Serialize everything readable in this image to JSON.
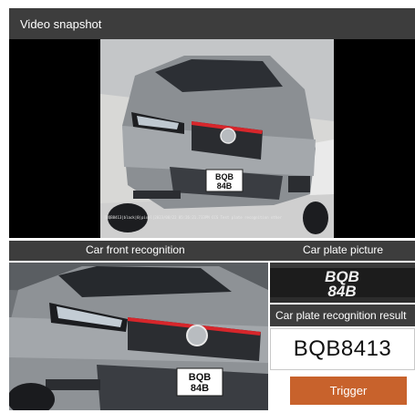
{
  "header": {
    "title": "Video snapshot"
  },
  "video": {
    "caption": "[BQB8413|black|0|pixel|2023/08/22 05:26:21.733PM CCS Test plate recognition other"
  },
  "sections": {
    "front_label": "Car front recognition",
    "plate_label": "Car plate picture",
    "result_label": "Car plate recognition result"
  },
  "plate": {
    "picture_line1": "BQB",
    "picture_line2": "84B",
    "result": "BQB8413"
  },
  "button": {
    "trigger_label": "Trigger"
  },
  "colors": {
    "header_bg": "#3d3d3d",
    "accent": "#c8622c",
    "car_body": "#8e9296",
    "grille_trim": "#d7262b"
  },
  "icons": []
}
